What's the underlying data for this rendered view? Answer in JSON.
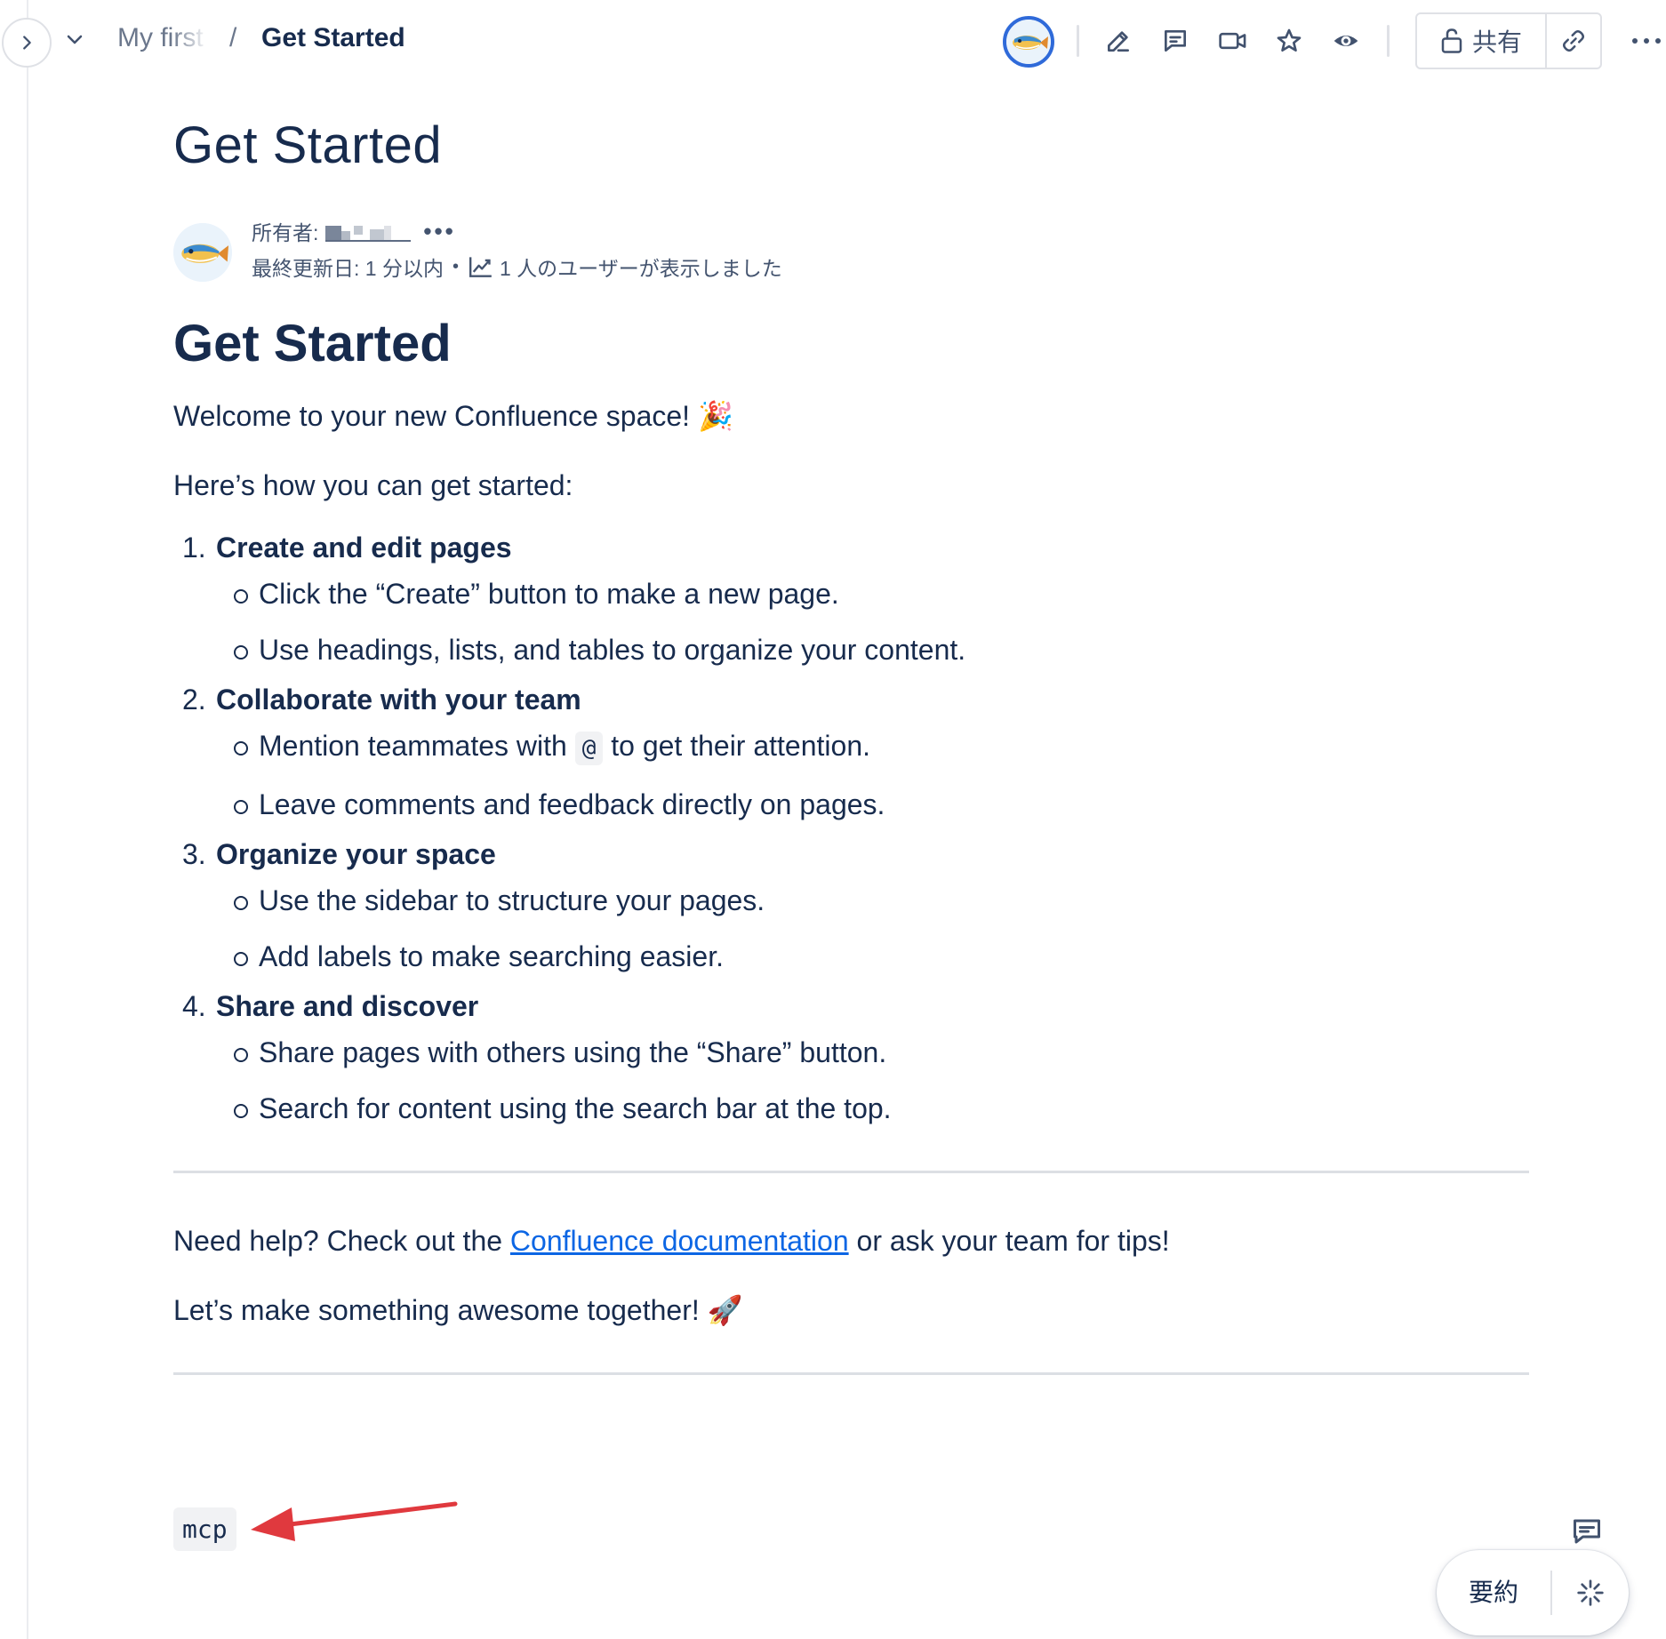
{
  "breadcrumb": {
    "parent": "My first space",
    "separator": "/",
    "current": "Get Started"
  },
  "toolbar": {
    "icons": [
      "edit-icon",
      "comment-icon",
      "video-icon",
      "star-icon",
      "watch-icon"
    ],
    "share_label": "共有",
    "copy_link_icon": "link-icon",
    "more_icon": "more-icon"
  },
  "page": {
    "title": "Get Started",
    "byline": {
      "owner_label": "所有者:",
      "owner_more": "•••",
      "last_updated": "最終更新日: 1 分以内",
      "separator": "•",
      "views": "1 人のユーザーが表示しました"
    }
  },
  "body": {
    "heading": "Get Started",
    "welcome": "Welcome to your new Confluence space! 🎉",
    "how": "Here’s how you can get started:",
    "steps": [
      {
        "number": "1.",
        "title": "Create and edit pages",
        "items": [
          "Click the “Create” button to make a new page.",
          "Use headings, lists, and tables to organize your content."
        ]
      },
      {
        "number": "2.",
        "title": "Collaborate with your team",
        "items": [
          {
            "before": "Mention teammates with",
            "code": "@",
            "after": "to get their attention."
          },
          "Leave comments and feedback directly on pages."
        ]
      },
      {
        "number": "3.",
        "title": "Organize your space",
        "items": [
          "Use the sidebar to structure your pages.",
          "Add labels to make searching easier."
        ]
      },
      {
        "number": "4.",
        "title": "Share and discover",
        "items": [
          "Share pages with others using the “Share” button.",
          "Search for content using the search bar at the top."
        ]
      }
    ],
    "help": {
      "before": "Need help? Check out the",
      "link": "Confluence documentation",
      "after": "or ask your team for tips!"
    },
    "closing": "Let’s make something awesome together! 🚀",
    "code_chip": "mcp"
  },
  "floating": {
    "summary_label": "要約",
    "ai_icon": "sparkle-icon"
  },
  "colors": {
    "link": "#0c66e4",
    "annotation_arrow": "#e0393e",
    "avatar_ring": "#2f6ad9"
  }
}
